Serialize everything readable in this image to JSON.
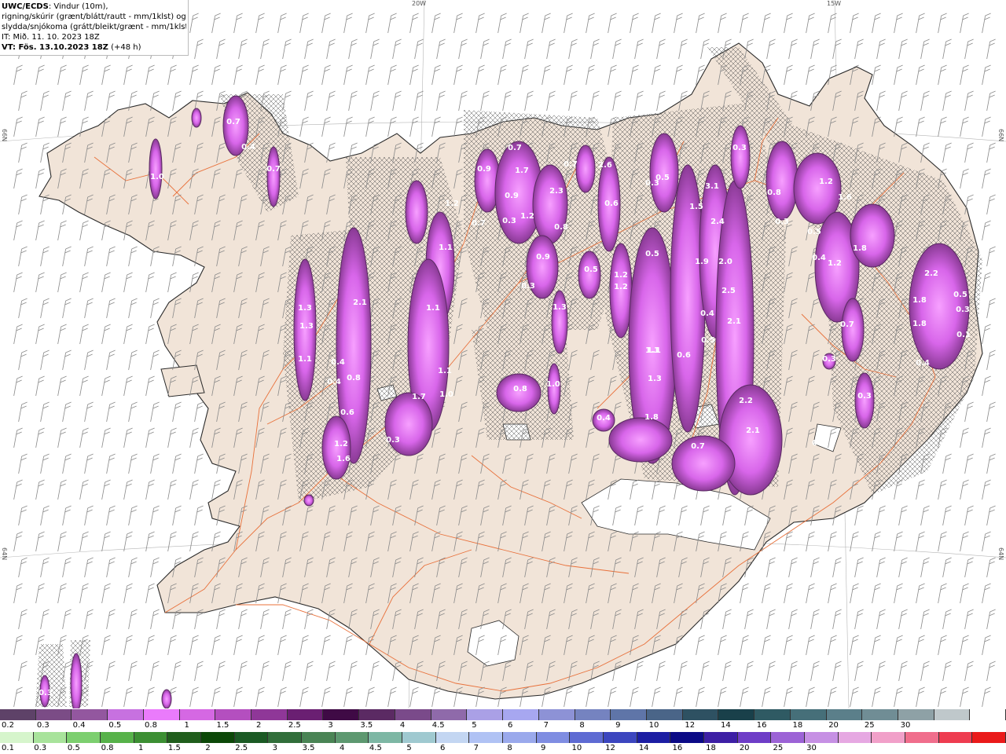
{
  "header": {
    "title_bold": "UWC/ECDS",
    "title_rest": ": Vindur (10m),",
    "line2": "rigning/skúrir (grænt/blátt/rautt - mm/1klst) og",
    "line3": "slydda/snjókoma (grátt/bleikt/grænt - mm/1klst)",
    "it_line": "IT: Mið. 11. 10. 2023 18Z",
    "vt_label": "VT: Fös. 13.10.2023 18Z",
    "vt_rest": " (+48 h)"
  },
  "coords": {
    "top_20w": "20W",
    "top_15w": "15W",
    "left_66n": "66N",
    "right_66n": "66N",
    "left_64n": "64N",
    "right_64n": "64N"
  },
  "colors": {
    "land": "#f1e4d8",
    "coast": "#2a2a2a",
    "roads": "#e8703a",
    "barbs": "#8a8a8a",
    "precip_light": "#dd6fe8",
    "precip_mid": "#c25ad6",
    "precip_dark": "#7a3a82",
    "precip_peak": "#ee88ff"
  },
  "precip_values": [
    "0.7",
    "0.4",
    "0.7",
    "1.0",
    "1.3",
    "1.3",
    "1.1",
    "0.4",
    "0.4",
    "2.1",
    "0.8",
    "0.6",
    "1.2",
    "1.6",
    "1.1",
    "1.7",
    "1.1",
    "1.0",
    "0.3",
    "1.1",
    "1.2",
    "0.7",
    "0.9",
    "1.7",
    "0.9",
    "0.3",
    "1.2",
    "2.3",
    "0.8",
    "0.7",
    "0.7",
    "2.6",
    "0.6",
    "0.3",
    "0.9",
    "0.5",
    "1.2",
    "1.2",
    "1.3",
    "1.0",
    "0.8",
    "0.5",
    "1.1",
    "0.3",
    "0.5",
    "1.5",
    "3.1",
    "2.4",
    "1.9",
    "2.0",
    "2.5",
    "2.1",
    "0.4",
    "0.5",
    "0.6",
    "1.1",
    "1.3",
    "1.8",
    "0.4",
    "0.7",
    "2.2",
    "2.1",
    "0.3",
    "1.2",
    "1.6",
    "1.8",
    "1.2",
    "0.5",
    "0.4",
    "0.8",
    "0.3",
    "0.7",
    "0.3",
    "0.3",
    "2.2",
    "1.8",
    "1.8",
    "0.4",
    "0.5",
    "0.3",
    "0.1",
    "0.3",
    "0.3"
  ],
  "legend_snow": {
    "colors": [
      "#5e4268",
      "#7b4c86",
      "#93579f",
      "#c771e0",
      "#ea7bfb",
      "#d568e3",
      "#b44fbf",
      "#8f3798",
      "#6a1f72",
      "#3f0a45",
      "#5b2a63",
      "#7a4a8a",
      "#8f6aaa",
      "#aaa0e6",
      "#a7a7f0",
      "#8d92d6",
      "#7583c0",
      "#5f75a8",
      "#4a6588",
      "#2e5162",
      "#19404a",
      "#2f5a63",
      "#466f79",
      "#5b7f8a",
      "#708d95",
      "#8ea1a6",
      "#bfc8cb",
      "#ffffff"
    ],
    "labels": [
      "0.2",
      "0.3",
      "0.4",
      "0.5",
      "0.8",
      "1",
      "1.5",
      "2",
      "2.5",
      "3",
      "3.5",
      "4",
      "4.5",
      "5",
      "6",
      "7",
      "8",
      "9",
      "10",
      "12",
      "14",
      "16",
      "18",
      "20",
      "25",
      "30"
    ]
  },
  "legend_rain": {
    "colors": [
      "#d6f5cc",
      "#a8e39b",
      "#7ccf6f",
      "#57b24a",
      "#3c8f33",
      "#205e1c",
      "#0c4808",
      "#1b5a24",
      "#316e3a",
      "#4a8455",
      "#5d9870",
      "#7db7a4",
      "#9fc9d0",
      "#c3d6f2",
      "#b0c2f4",
      "#9aa9ec",
      "#7f8de2",
      "#5e6bd3",
      "#3c46bf",
      "#1c1ea3",
      "#0b0a86",
      "#3d1fa5",
      "#6e3dc7",
      "#9c63d6",
      "#c690e4",
      "#e6a8e2",
      "#f1a0c9",
      "#f06e8c",
      "#ee3c50",
      "#ea1a1a"
    ],
    "labels": [
      "0.1",
      "0.3",
      "0.5",
      "0.8",
      "1",
      "1.5",
      "2",
      "2.5",
      "3",
      "3.5",
      "4",
      "4.5",
      "5",
      "6",
      "7",
      "8",
      "9",
      "10",
      "12",
      "14",
      "16",
      "18",
      "20",
      "25",
      "30"
    ]
  }
}
